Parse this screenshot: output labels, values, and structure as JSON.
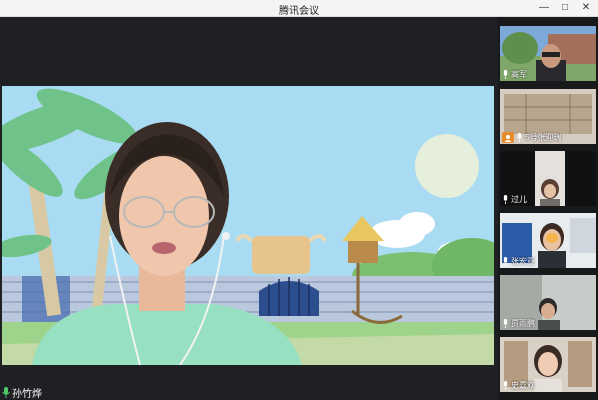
{
  "window": {
    "title": "腾讯会议",
    "minimize_glyph": "—",
    "maximize_glyph": "□",
    "close_glyph": "✕"
  },
  "main_speaker": {
    "name": "孙竹烨"
  },
  "participants": [
    {
      "name": "高军"
    },
    {
      "name": "5号张迎瑞"
    },
    {
      "name": "过儿"
    },
    {
      "name": "张宏亚"
    },
    {
      "name": "贾雨鹏"
    },
    {
      "name": "史嘉欢"
    }
  ],
  "colors": {
    "mic_active": "#4dcc6a",
    "badge": "#e8892a",
    "sky": "#a6d8f0",
    "grass": "#8fcf7e"
  }
}
